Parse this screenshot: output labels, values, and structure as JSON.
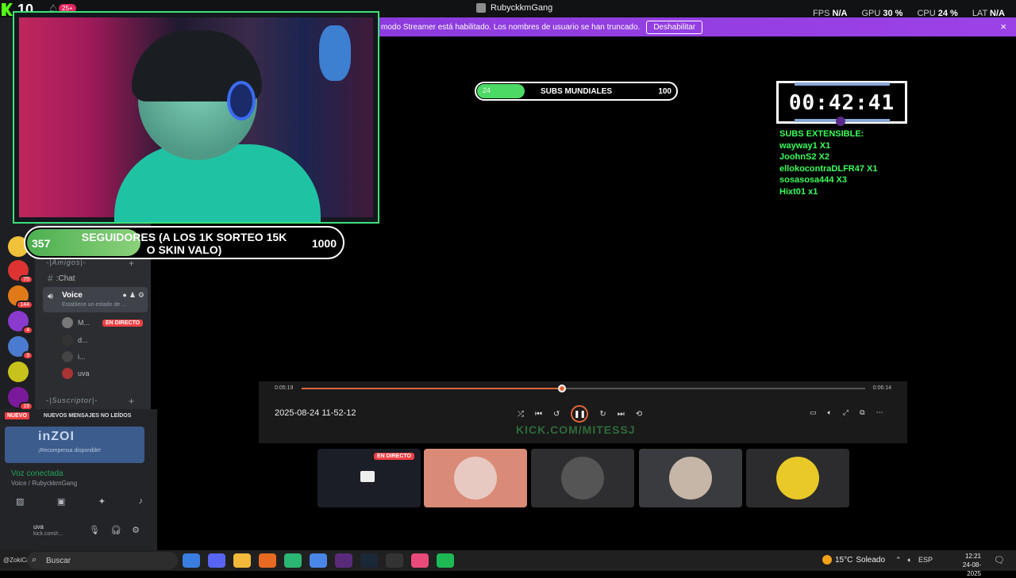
{
  "topbar": {
    "count": "10",
    "notif_badge": "25+",
    "window_title": "RubyckkmGang",
    "fps_label": "FPS",
    "fps_value": "N/A",
    "gpu_label": "GPU",
    "gpu_value": "30 %",
    "cpu_label": "CPU",
    "cpu_value": "24 %",
    "lat_label": "LAT",
    "lat_value": "N/A"
  },
  "banner": {
    "text": "modo Streamer está habilitado. Los nombres de usuario se han truncado.",
    "button": "Deshabilitar",
    "close_icon": "×"
  },
  "followers_goal": {
    "current": "357",
    "label": "SEGUIDORES (A LOS 1K SORTEO 15K O SKIN VALO)",
    "target": "1000",
    "progress": 0.357
  },
  "subs_goal": {
    "current": "24",
    "label": "SUBS MUNDIALES",
    "target": "100",
    "progress": 0.24
  },
  "timer": {
    "time": "00:42:41"
  },
  "subs_extensible": {
    "title": "SUBS EXTENSIBLE:",
    "items": [
      "wayway1 X1",
      "JoohnS2 X2",
      "ellokocontraDLFR47 X1",
      "sosasosa444 X3",
      "Hixt01 x1"
    ]
  },
  "discord": {
    "categories": {
      "amigos": "-|Amigos|-",
      "suscriptor": "-|Suscriptor|-"
    },
    "chat_channel": ":Chat",
    "voice_channel": {
      "name": "Voice",
      "status": "Establece un estado de ..."
    },
    "voice_users": [
      {
        "name": "M...",
        "live": "EN DIRECTO"
      },
      {
        "name": "d..."
      },
      {
        "name": "i..."
      },
      {
        "name": "uva"
      }
    ],
    "server_badges": [
      "75",
      "144",
      "4",
      "3",
      "19"
    ],
    "new_messages": {
      "tag": "NUEVO",
      "text": "NUEVOS MENSAJES NO LEÍDOS"
    },
    "game_card": {
      "name": "inZOI",
      "reward": "¡Recompensa disponible!"
    },
    "voice_connected": "Voz conectada",
    "voice_location": "Voice / RubyckkmGang",
    "user_name": "uva",
    "user_sub": "kick.com/r..."
  },
  "player": {
    "time_current": "0:05:19",
    "time_total": "0:06:14",
    "progress": 0.4625,
    "file_name": "2025-08-24 11-52-12"
  },
  "watermark": "KICK.COM/MITESSJ",
  "tiles": {
    "live_badge": "EN DIRECTO"
  },
  "taskbar": {
    "user": "@ZokiCash",
    "search_placeholder": "Buscar",
    "temperature": "15°C",
    "weather": "Soleado",
    "lang": "ESP",
    "time": "12:21",
    "date": "24-08-2025"
  },
  "colors": {
    "accent_green": "#3ee07a",
    "banner_purple": "#9b42e6",
    "live_red": "#f23f43",
    "player_orange": "#e0663a",
    "subs_text_green": "#3aff5a"
  }
}
